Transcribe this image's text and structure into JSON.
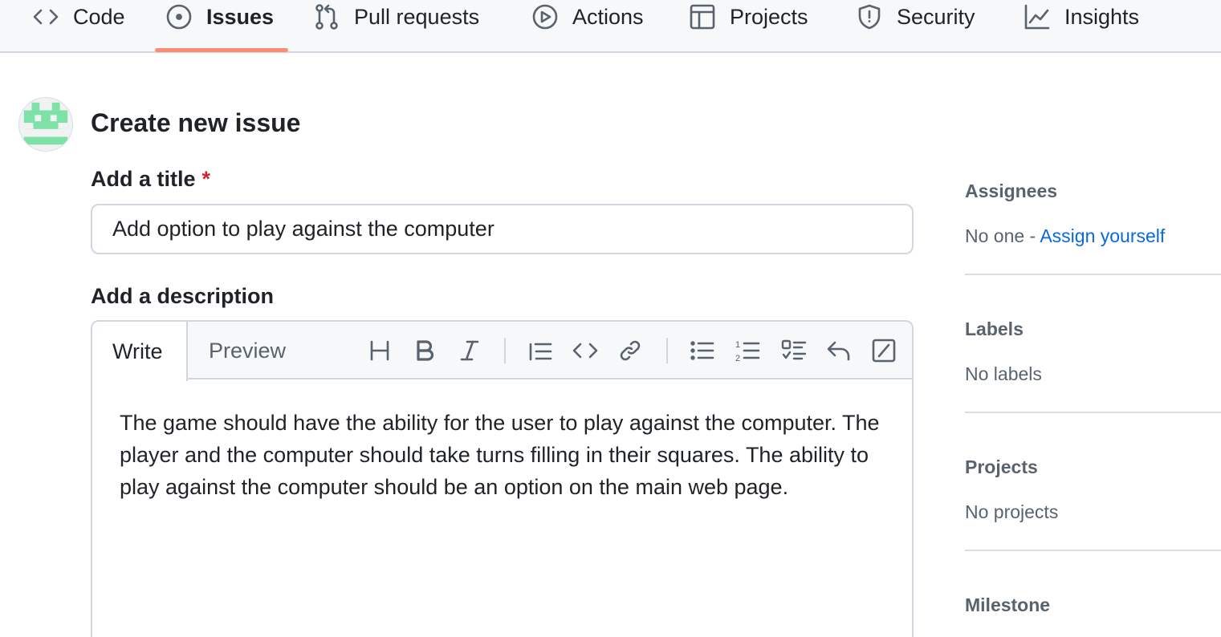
{
  "nav": {
    "tabs": [
      {
        "label": "Code",
        "icon": "code-icon"
      },
      {
        "label": "Issues",
        "icon": "issue-opened-icon",
        "selected": true
      },
      {
        "label": "Pull requests",
        "icon": "git-pull-request-icon"
      },
      {
        "label": "Actions",
        "icon": "play-icon"
      },
      {
        "label": "Projects",
        "icon": "table-icon"
      },
      {
        "label": "Security",
        "icon": "shield-icon"
      },
      {
        "label": "Insights",
        "icon": "graph-icon"
      }
    ],
    "selected_underline_color": "#fd8c73"
  },
  "header": {
    "title": "Create new issue"
  },
  "form": {
    "title_label": "Add a title",
    "required_mark": "*",
    "title_value": "Add option to play against the computer",
    "description_label": "Add a description",
    "editor": {
      "tabs": {
        "write": "Write",
        "preview": "Preview"
      },
      "toolbar_icons": [
        "heading-icon",
        "bold-icon",
        "italic-icon",
        "quote-icon",
        "code-icon",
        "link-icon",
        "unordered-list-icon",
        "ordered-list-icon",
        "task-list-icon",
        "reply-icon",
        "slash-command-icon"
      ],
      "body": "The game should have the ability for the user to play against the computer. The player and the computer should take turns filling in their squares. The ability to play against the computer should be an option on the main web page."
    }
  },
  "sidebar": {
    "assignees": {
      "heading": "Assignees",
      "value_prefix": "No one - ",
      "action": "Assign yourself"
    },
    "labels": {
      "heading": "Labels",
      "value": "No labels"
    },
    "projects": {
      "heading": "Projects",
      "value": "No projects"
    },
    "milestone": {
      "heading": "Milestone"
    }
  },
  "colors": {
    "link": "#0969da",
    "required": "#d1242f",
    "avatar_green": "#7ee2a8"
  }
}
